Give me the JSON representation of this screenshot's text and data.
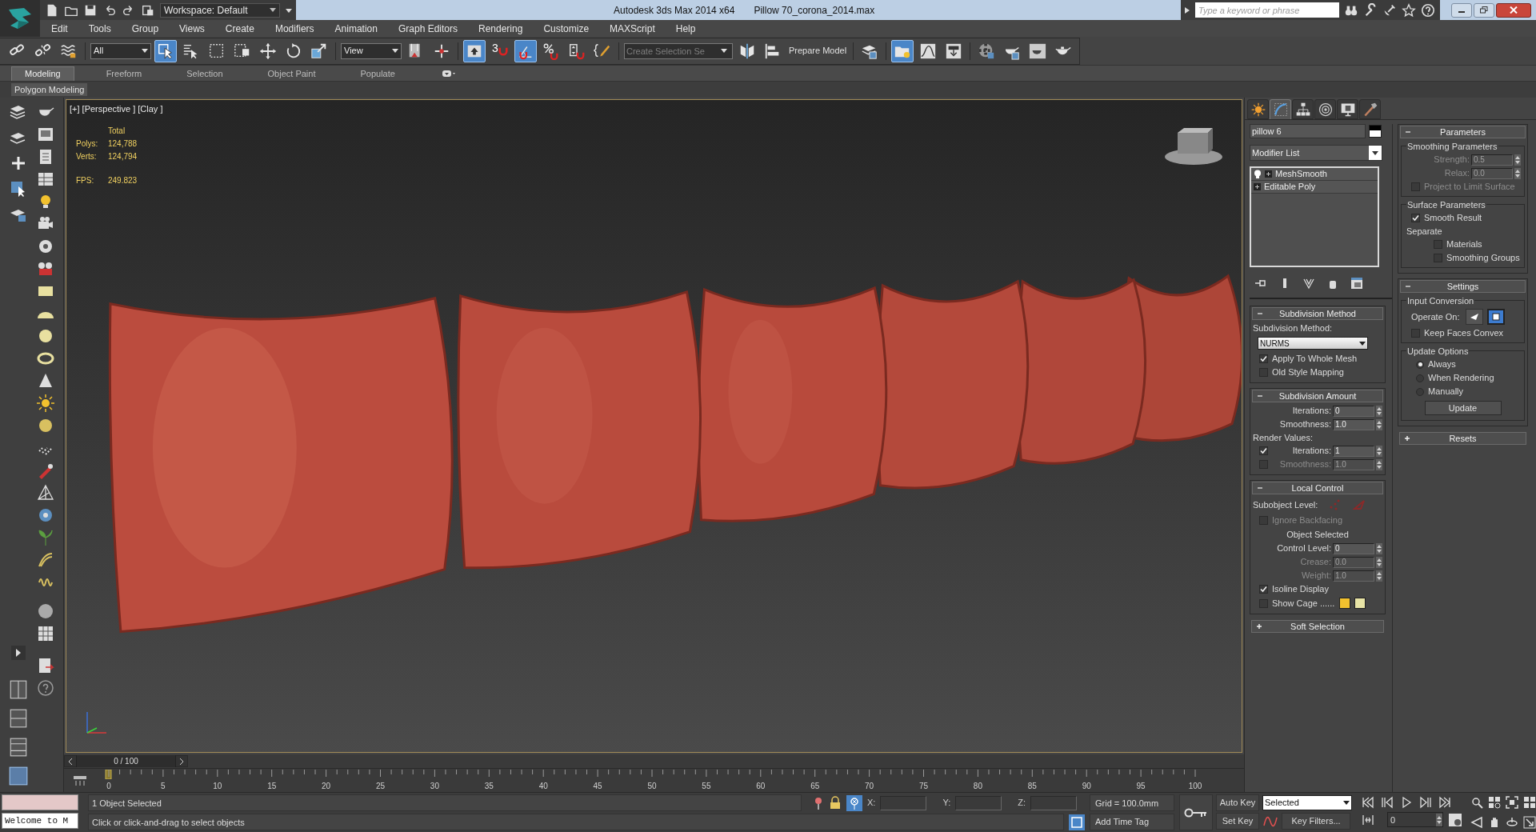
{
  "title_bar": {
    "workspace": "Workspace: Default",
    "app_title": "Autodesk 3ds Max  2014 x64",
    "file_name": "Pillow 70_corona_2014.max",
    "search": {
      "placeholder": "Type a keyword or phrase"
    }
  },
  "menu": [
    "Edit",
    "Tools",
    "Group",
    "Views",
    "Create",
    "Modifiers",
    "Animation",
    "Graph Editors",
    "Rendering",
    "Customize",
    "MAXScript",
    "Help"
  ],
  "main_toolbar": [
    {
      "kind": "link",
      "on": false
    },
    {
      "kind": "unlink",
      "on": false
    },
    {
      "kind": "wave",
      "on": false
    },
    {
      "kind": "dropdown",
      "value": "All"
    },
    {
      "kind": "select",
      "on": true
    },
    {
      "kind": "select_list",
      "on": false
    },
    {
      "kind": "rect",
      "on": false
    },
    {
      "kind": "crossing",
      "on": false
    },
    {
      "kind": "move",
      "on": false
    },
    {
      "kind": "rotate",
      "on": false
    },
    {
      "kind": "scale",
      "on": false
    },
    {
      "kind": "dropdown",
      "value": "View"
    },
    {
      "kind": "pivot",
      "on": false
    },
    {
      "kind": "manip",
      "on": false
    },
    {
      "kind": "keyboard",
      "on": true
    },
    {
      "kind": "snap",
      "text": "3",
      "on": false
    },
    {
      "kind": "angle",
      "on": true
    },
    {
      "kind": "percent",
      "on": false
    },
    {
      "kind": "spinner",
      "on": false
    },
    {
      "kind": "named",
      "on": false
    },
    {
      "kind": "selection_set",
      "placeholder": "Create Selection Se"
    },
    {
      "kind": "mirror",
      "on": false
    },
    {
      "kind": "align",
      "on": false
    },
    {
      "kind": "label",
      "text": "Prepare Model"
    },
    {
      "kind": "layers",
      "on": false
    },
    {
      "kind": "explorer",
      "on": true
    },
    {
      "kind": "curve",
      "on": false
    },
    {
      "kind": "schematic",
      "on": false
    },
    {
      "kind": "material",
      "on": false
    },
    {
      "kind": "render_setup",
      "on": false
    },
    {
      "kind": "frame",
      "on": false
    },
    {
      "kind": "teapot",
      "on": false
    }
  ],
  "ribbon": {
    "tabs": [
      {
        "label": "Modeling",
        "selected": true
      },
      {
        "label": "Freeform",
        "selected": false
      },
      {
        "label": "Selection",
        "selected": false
      },
      {
        "label": "Object Paint",
        "selected": false
      },
      {
        "label": "Populate",
        "selected": false
      }
    ],
    "panel": "Polygon Modeling"
  },
  "viewport": {
    "label": "[+] [Perspective ] [Clay ]",
    "stats": {
      "header": "Total",
      "rows": [
        {
          "label": "Polys:",
          "value": "124,788"
        },
        {
          "label": "Verts:",
          "value": "124,794"
        }
      ],
      "fps_label": "FPS:",
      "fps_value": "249.823"
    }
  },
  "command_panel": {
    "tabs": [
      {
        "kind": "create",
        "selected": false
      },
      {
        "kind": "modify",
        "selected": true
      },
      {
        "kind": "hierarchy",
        "selected": false
      },
      {
        "kind": "motion",
        "selected": false
      },
      {
        "kind": "display",
        "selected": false
      },
      {
        "kind": "utilities",
        "selected": false
      }
    ],
    "object_name": "pillow 6",
    "modifier_list": "Modifier List",
    "stack": [
      {
        "label": "MeshSmooth",
        "kind": "modifier"
      },
      {
        "label": "Editable Poly",
        "kind": "base"
      }
    ],
    "left_rollouts": [
      {
        "title": "Subdivision Method",
        "expanded": true,
        "controls": [
          {
            "kind": "label",
            "text": "Subdivision Method:"
          },
          {
            "kind": "dropdown",
            "value": "NURMS"
          },
          {
            "kind": "checkbox",
            "label": "Apply To Whole Mesh",
            "checked": true,
            "disabled": false
          },
          {
            "kind": "checkbox",
            "label": "Old Style Mapping",
            "checked": false,
            "disabled": false
          }
        ]
      },
      {
        "title": "Subdivision Amount",
        "expanded": true,
        "controls": [
          {
            "kind": "spinner",
            "label": "Iterations:",
            "value": "0",
            "disabled": false
          },
          {
            "kind": "spinner",
            "label": "Smoothness:",
            "value": "1.0",
            "disabled": false
          },
          {
            "kind": "label",
            "text": "Render Values:"
          },
          {
            "kind": "check_spinner",
            "label": "Iterations:",
            "value": "1",
            "checked": true,
            "disabled": false
          },
          {
            "kind": "check_spinner",
            "label": "Smoothness:",
            "value": "1.0",
            "checked": false,
            "disabled": true
          }
        ]
      },
      {
        "title": "Local Control",
        "expanded": true,
        "controls": [
          {
            "kind": "subobject",
            "label": "Subobject Level:"
          },
          {
            "kind": "checkbox",
            "label": "Ignore Backfacing",
            "checked": false,
            "disabled": true
          },
          {
            "kind": "center_label",
            "text": "Object Selected"
          },
          {
            "kind": "spinner",
            "label": "Control Level:",
            "value": "0",
            "disabled": false
          },
          {
            "kind": "spinner",
            "label": "Crease:",
            "value": "0.0",
            "disabled": true
          },
          {
            "kind": "spinner",
            "label": "Weight:",
            "value": "1.0",
            "disabled": true
          },
          {
            "kind": "checkbox",
            "label": "Isoline Display",
            "checked": true,
            "disabled": false
          },
          {
            "kind": "cage",
            "label": "Show Cage ......",
            "checked": false,
            "swatches": [
              {
                "color": "#f2c12e"
              },
              {
                "color": "#e8e4a6"
              }
            ]
          }
        ]
      },
      {
        "title": "Soft Selection",
        "expanded": false
      }
    ],
    "right_rollouts": [
      {
        "title": "Parameters",
        "expanded": true,
        "controls": [
          {
            "kind": "group",
            "title": "Smoothing Parameters",
            "controls": [
              {
                "kind": "spinner",
                "label": "Strength:",
                "value": "0.5",
                "disabled": true
              },
              {
                "kind": "spinner",
                "label": "Relax:",
                "value": "0.0",
                "disabled": true
              },
              {
                "kind": "checkbox",
                "label": "Project to Limit Surface",
                "checked": false,
                "disabled": true
              }
            ]
          },
          {
            "kind": "group",
            "title": "Surface Parameters",
            "controls": [
              {
                "kind": "checkbox",
                "label": "Smooth Result",
                "checked": true,
                "disabled": false
              },
              {
                "kind": "subgroup",
                "label": "Separate",
                "children": [
                  {
                    "kind": "checkbox",
                    "label": "Materials",
                    "checked": false,
                    "disabled": false
                  },
                  {
                    "kind": "checkbox",
                    "label": "Smoothing Groups",
                    "checked": false,
                    "disabled": false
                  }
                ]
              }
            ]
          }
        ]
      },
      {
        "title": "Settings",
        "expanded": true,
        "controls": [
          {
            "kind": "group",
            "title": "Input Conversion",
            "controls": [
              {
                "kind": "operate_on",
                "label": "Operate On:",
                "buttons": [
                  {
                    "kind": "triangle",
                    "selected": false
                  },
                  {
                    "kind": "polygon",
                    "selected": true
                  }
                ]
              },
              {
                "kind": "checkbox",
                "label": "Keep Faces Convex",
                "checked": false,
                "disabled": false
              }
            ]
          },
          {
            "kind": "group",
            "title": "Update Options",
            "controls": [
              {
                "kind": "radio",
                "label": "Always",
                "selected": true
              },
              {
                "kind": "radio",
                "label": "When Rendering",
                "selected": false
              },
              {
                "kind": "radio",
                "label": "Manually",
                "selected": false
              },
              {
                "kind": "button",
                "label": "Update"
              }
            ]
          }
        ]
      },
      {
        "title": "Resets",
        "expanded": false
      }
    ]
  },
  "timeline": {
    "position": "0 / 100",
    "level": 0,
    "ticks": [
      "0",
      "5",
      "10",
      "15",
      "20",
      "25",
      "30",
      "35",
      "40",
      "45",
      "50",
      "55",
      "60",
      "65",
      "70",
      "75",
      "80",
      "85",
      "90",
      "95",
      "100"
    ]
  },
  "status_bar": {
    "listener_output": "Welcome to M",
    "selection": "1 Object Selected",
    "prompt": "Click or click-and-drag to select objects",
    "x_label": "X:",
    "y_label": "Y:",
    "z_label": "Z:",
    "grid": "Grid = 100.0mm",
    "time_tag": "Add Time Tag",
    "auto_key": "Auto Key",
    "set_key": "Set Key",
    "key_mode": "Selected",
    "key_filters": "Key Filters...",
    "frame": "0"
  }
}
